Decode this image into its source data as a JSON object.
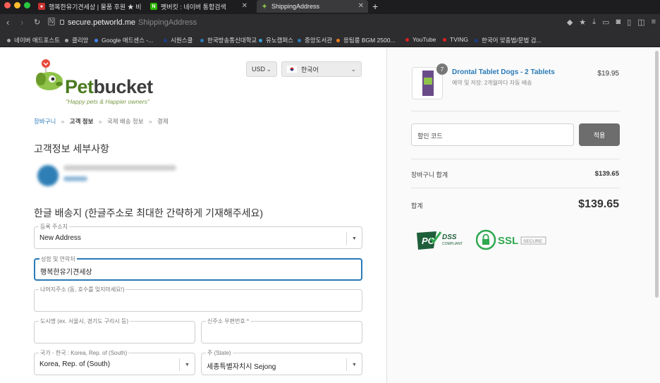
{
  "browser": {
    "tabs": [
      {
        "title": "행복한유기견세상 | 물품 후원 ★ 비",
        "favicon_color": "#c8322f",
        "favicon_glyph": "●"
      },
      {
        "title": "펫버킷 : 네이버 통합검색",
        "favicon_color": "#2db400",
        "favicon_glyph": "N"
      },
      {
        "title": "ShippingAddress",
        "favicon_color": "#8fc34a",
        "favicon_glyph": "✦"
      }
    ],
    "url": {
      "host": "secure.petworld.me",
      "path": "ShippingAddress"
    },
    "bookmarks": [
      {
        "label": "네이버 애드포스트",
        "color": "#aaaaaa"
      },
      {
        "label": "클리앙",
        "color": "#aaaaaa"
      },
      {
        "label": "Google 애드센스 -...",
        "color": "#4285f4"
      },
      {
        "label": "시원스쿨",
        "color": "#1a3b8a"
      },
      {
        "label": "한국방송통신대학교",
        "color": "#2a7ab8"
      },
      {
        "label": "유노캠퍼스",
        "color": "#3aa0d8"
      },
      {
        "label": "중앙도서관",
        "color": "#2a7ab8"
      },
      {
        "label": "응팀룸 BGM 2500...",
        "color": "#f07a1a"
      },
      {
        "label": "YouTube",
        "color": "#e02020"
      },
      {
        "label": "TVING",
        "color": "#e02020"
      },
      {
        "label": "한국어 맞춤법/문법 검...",
        "color": "#1a3b8a"
      }
    ]
  },
  "header": {
    "logo_text_a": "Pet",
    "logo_text_b": "bucket",
    "logo_tagline": "\"Happy pets & Happier owners\"",
    "currency": "USD",
    "language": "한국어"
  },
  "breadcrumb": {
    "step1": "장바구니",
    "step2": "고객 정보",
    "step3": "국제 배송 정보",
    "step4": "결제",
    "sep": "»"
  },
  "customer": {
    "heading": "고객정보 세부사항"
  },
  "shipping": {
    "heading": "한글 배송지 (한글주소로 최대한 간략하게 기재해주세요)",
    "fields": {
      "saved_address": {
        "label": "등록 주소지",
        "value": "New Address"
      },
      "name_contact": {
        "label": "성함 및 연락처",
        "value": "행복한유기견세상"
      },
      "rest_address": {
        "label": "나머지주소 (동, 호수를 잊지마세요!)",
        "value": ""
      },
      "city": {
        "label": "도시명 (ex. 서울시, 경기도 구리시 등)",
        "value": ""
      },
      "zip": {
        "label": "신주소 우편번호 *",
        "value": ""
      },
      "country": {
        "label": "국가 - 한국 : Korea, Rep. of (South)",
        "value": "Korea, Rep. of (South)"
      },
      "state": {
        "label": "주 (State)",
        "value": "세종특별자치시 Sejong"
      }
    }
  },
  "order_summary": {
    "product": {
      "name": "Drontal Tablet Dogs - 2 Tablets",
      "subtitle": "예약 및 저장: 2개월마다 자동 배송",
      "price": "$19.95",
      "quantity": "7"
    },
    "discount": {
      "placeholder": "할인 코드",
      "apply_label": "적용"
    },
    "subtotal": {
      "label": "장바구니 합계",
      "value": "$139.65"
    },
    "total": {
      "label": "합계",
      "value": "$139.65"
    },
    "badges": {
      "pci": "DSS",
      "pci_sub": "COMPLIANT",
      "ssl": "SSL",
      "ssl_sub": "SECURE"
    }
  }
}
